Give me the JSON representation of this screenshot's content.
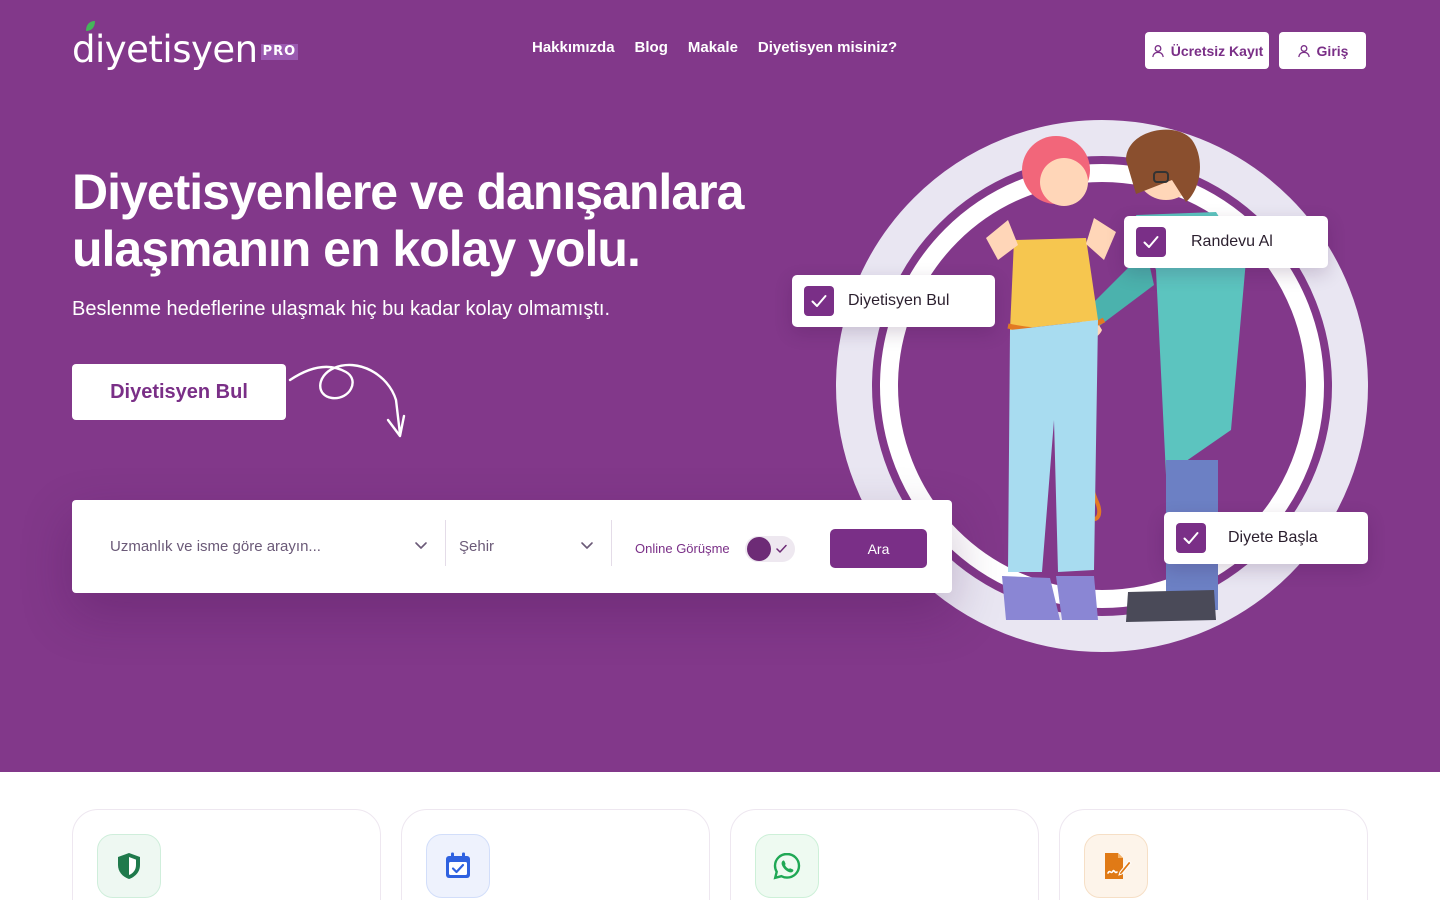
{
  "brand": {
    "name": "diyetisyen",
    "suffix": "PRO"
  },
  "nav": {
    "items": [
      "Hakkımızda",
      "Blog",
      "Makale",
      "Diyetisyen misiniz?"
    ]
  },
  "header": {
    "register_label": "Ücretsiz Kayıt",
    "login_label": "Giriş"
  },
  "hero": {
    "headline_line1": "Diyetisyenlere ve danışanlara",
    "headline_line2": "ulaşmanın en kolay yolu.",
    "subtitle": "Beslenme hedeflerine ulaşmak hiç bu kadar kolay olmamıştı.",
    "cta_label": "Diyetisyen Bul"
  },
  "search": {
    "specialty_placeholder": "Uzmanlık ve isme göre arayın...",
    "city_placeholder": "Şehir",
    "online_label": "Online Görüşme",
    "online_enabled": true,
    "submit_label": "Ara"
  },
  "illustration": {
    "tags": [
      "Diyetisyen Bul",
      "Randevu Al",
      "Diyete Başla"
    ]
  },
  "features": {
    "icons": [
      "shield-icon",
      "calendar-check-icon",
      "whatsapp-icon",
      "signed-document-icon"
    ]
  },
  "colors": {
    "brand_purple": "#82388a",
    "button_purple": "#7a2f87",
    "white": "#ffffff",
    "shield_green": "#1f7a4c",
    "calendar_blue": "#2f62e0",
    "whatsapp_green": "#1fa855",
    "document_orange": "#e07a16"
  }
}
